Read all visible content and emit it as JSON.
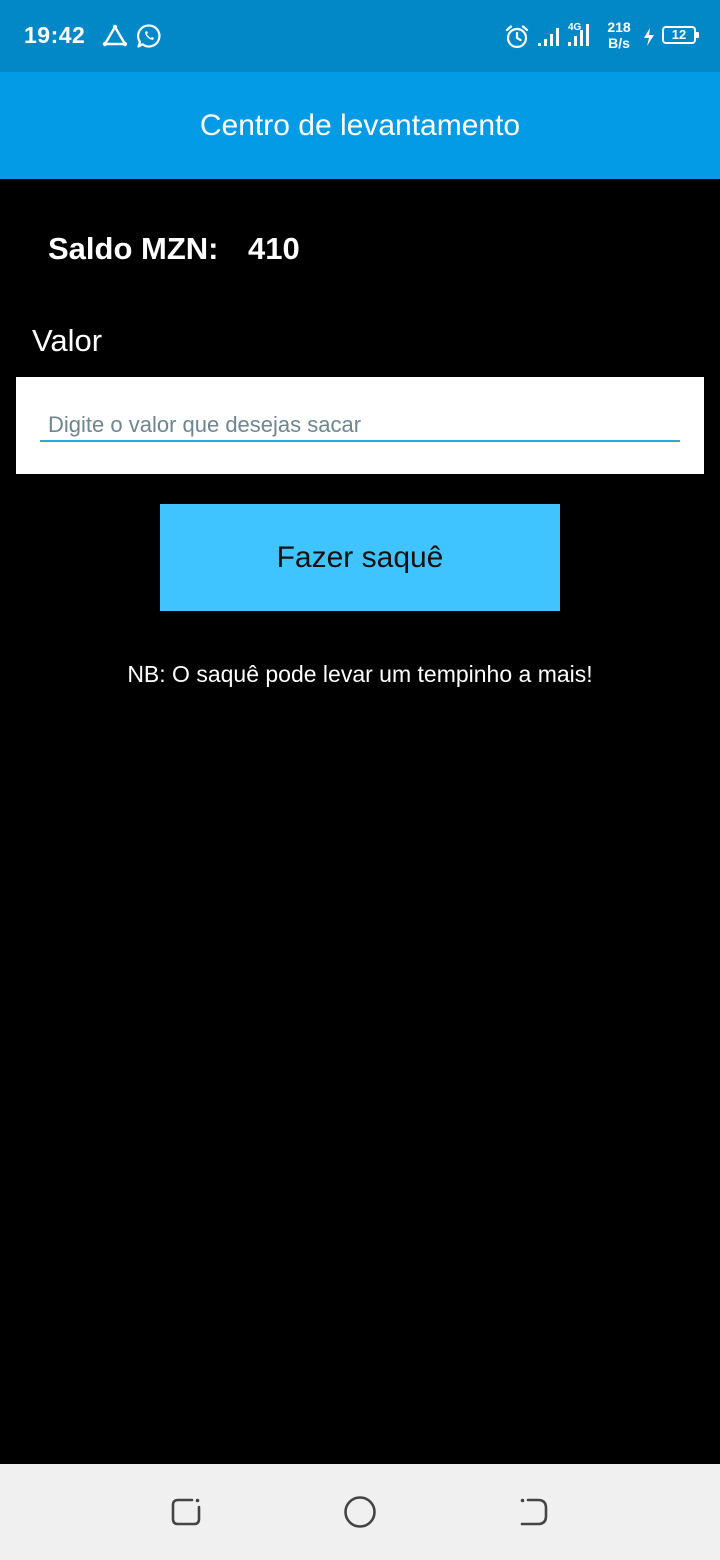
{
  "status_bar": {
    "time": "19:42",
    "net_speed_value": "218",
    "net_speed_unit": "B/s",
    "network_type": "4G",
    "battery_level": "12",
    "icons": [
      "app-notification-icon",
      "whatsapp-icon",
      "alarm-icon",
      "signal-icon",
      "signal-4g-icon",
      "charging-icon",
      "battery-icon"
    ]
  },
  "app_bar": {
    "title": "Centro de levantamento"
  },
  "balance": {
    "label": "Saldo MZN:",
    "value": "410"
  },
  "amount": {
    "label": "Valor",
    "value": "",
    "placeholder": "Digite o valor que desejas sacar"
  },
  "withdraw_button": {
    "label": "Fazer saquê"
  },
  "note": "NB: O saquê pode levar um tempinho a mais!",
  "nav_bar": {
    "items": [
      "recents-icon",
      "home-icon",
      "back-icon"
    ]
  },
  "colors": {
    "status_bar_bg": "#0288c7",
    "app_bar_bg": "#039be5",
    "button_bg": "#40c4ff",
    "page_bg": "#000000",
    "input_underline": "#29a8e0"
  }
}
